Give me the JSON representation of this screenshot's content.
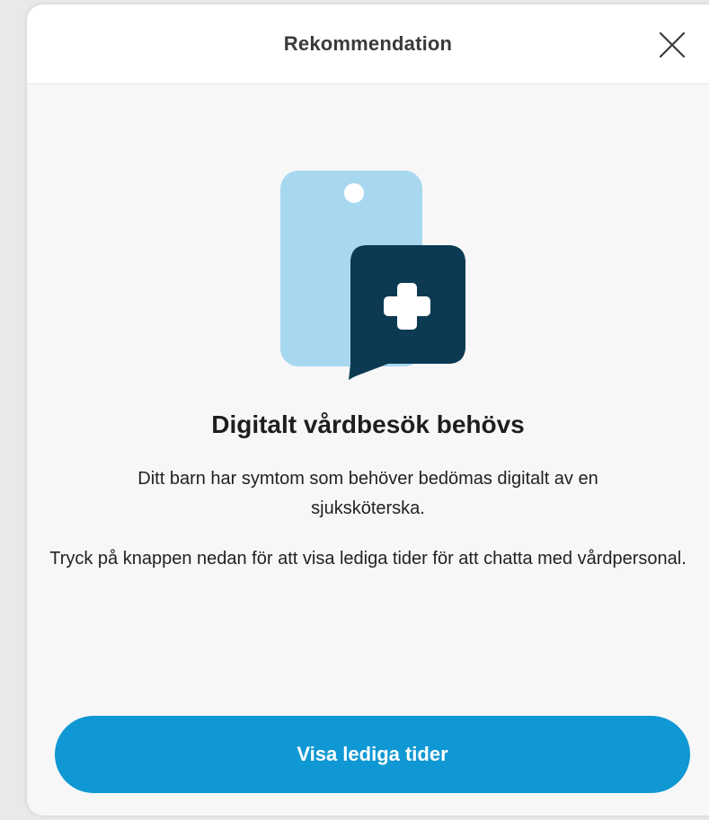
{
  "modal": {
    "title": "Rekommendation",
    "close_icon": "close-icon"
  },
  "illustration": {
    "icon": "phone-chat-medical-cross-icon",
    "colors": {
      "phone": "#a8d8f0",
      "bubble": "#0b3a52",
      "cross": "#ffffff"
    }
  },
  "content": {
    "heading": "Digitalt vårdbesök behövs",
    "paragraph_1": "Ditt barn har symtom som behöver bedömas digitalt av en sjuksköterska.",
    "paragraph_2": "Tryck på knappen nedan för att visa lediga tider för att chatta med vårdpersonal."
  },
  "actions": {
    "primary_button_label": "Visa lediga tider",
    "primary_color": "#0f98d3"
  }
}
